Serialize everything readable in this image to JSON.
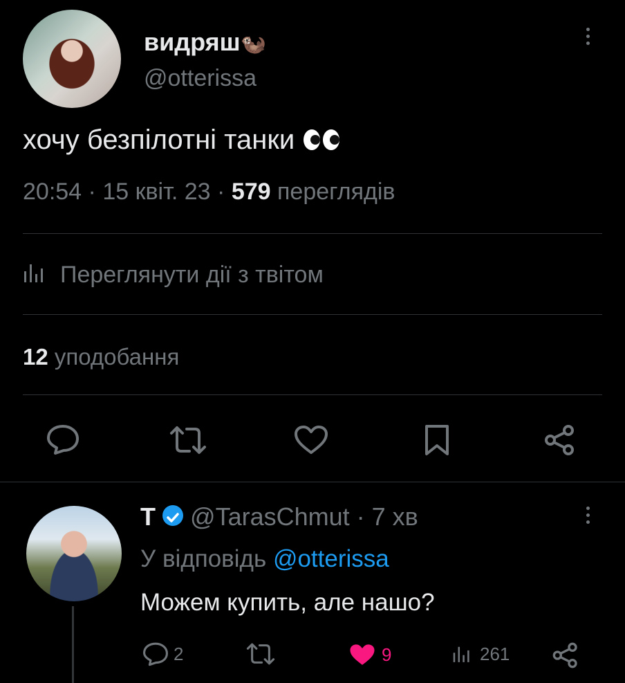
{
  "tweet": {
    "display_name": "видряш",
    "name_emoji": "🦦",
    "handle": "@otterissa",
    "text": "хочу безпілотні танки",
    "text_emoji": "👀",
    "time": "20:54",
    "date": "15 квіт. 23",
    "views_count": "579",
    "views_label": "переглядів",
    "activity_label": "Переглянути дії з твітом",
    "likes_count": "12",
    "likes_label": "уподобання",
    "accent_color": "#1d9bf0"
  },
  "actions": [
    "reply-icon",
    "retweet-icon",
    "like-icon",
    "bookmark-icon",
    "share-icon"
  ],
  "reply": {
    "display_name": "Т",
    "handle": "@TarasChmut",
    "age": "7 хв",
    "replying_prefix": "У відповідь",
    "replying_handle": "@otterissa",
    "text": "Можем купить, але нашо?",
    "reply_count": "2",
    "retweet_count": "",
    "like_count": "9",
    "view_count": "261",
    "like_color": "#f91880"
  }
}
